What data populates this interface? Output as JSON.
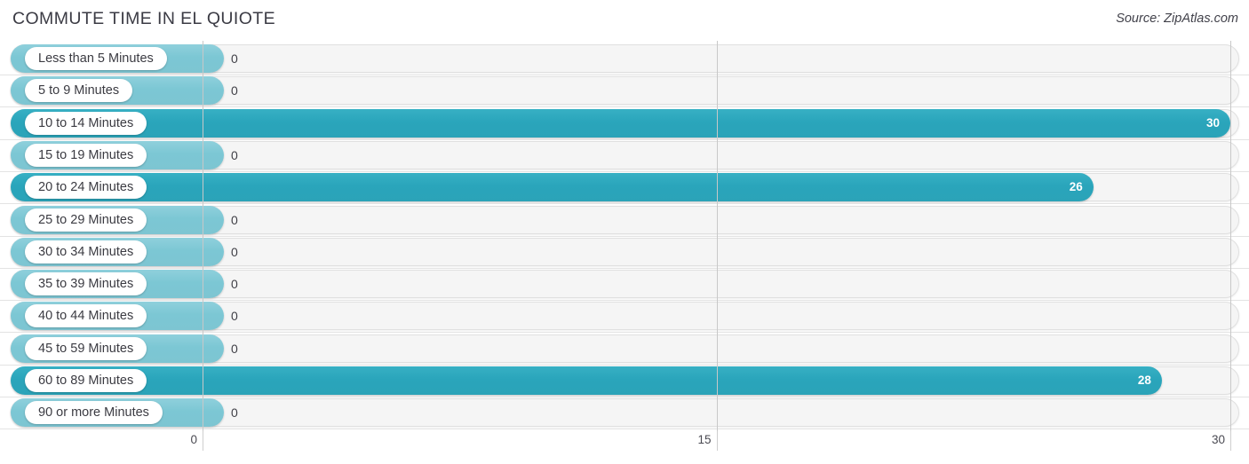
{
  "header": {
    "title": "COMMUTE TIME IN EL QUIOTE",
    "source": "Source: ZipAtlas.com"
  },
  "chart_data": {
    "type": "bar",
    "orientation": "horizontal",
    "title": "COMMUTE TIME IN EL QUIOTE",
    "xlabel": "",
    "ylabel": "",
    "xlim": [
      0,
      30
    ],
    "ticks": [
      "0",
      "15",
      "30"
    ],
    "tick_values": [
      0,
      15,
      30
    ],
    "grid": true,
    "legend": "none",
    "categories": [
      "Less than 5 Minutes",
      "5 to 9 Minutes",
      "10 to 14 Minutes",
      "15 to 19 Minutes",
      "20 to 24 Minutes",
      "25 to 29 Minutes",
      "30 to 34 Minutes",
      "35 to 39 Minutes",
      "40 to 44 Minutes",
      "45 to 59 Minutes",
      "60 to 89 Minutes",
      "90 or more Minutes"
    ],
    "values": [
      0,
      0,
      30,
      0,
      26,
      0,
      0,
      0,
      0,
      0,
      28,
      0
    ],
    "value_labels": [
      "0",
      "0",
      "30",
      "0",
      "26",
      "0",
      "0",
      "0",
      "0",
      "0",
      "28",
      "0"
    ],
    "colors": {
      "bar_high": "#2ba3b8",
      "bar_zero": "#7dc5d2",
      "track": "#f5f5f5",
      "gridline": "#c8c8c8",
      "label_pill": "#ffffff",
      "text": "#3b3b42"
    }
  }
}
